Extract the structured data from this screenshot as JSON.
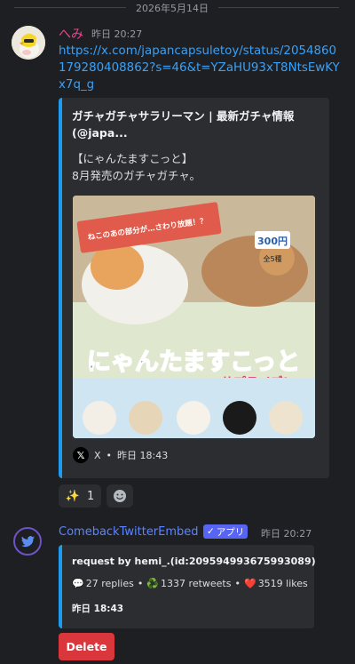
{
  "date_divider": "2026年5月14日",
  "message1": {
    "author": "へみ",
    "timestamp": "昨日 20:27",
    "link": "https://x.com/japancapsuletoy/status/2054860179280408862?s=46&t=YZaHU93xT8NtsEwKYx7q_g",
    "embed": {
      "title": "ガチャガチャサラリーマン | 最新ガチャ情報 (@japa...",
      "description_lines": [
        "【にゃんたますこっと】",
        "8月発売のガチャガチャ。"
      ],
      "image": {
        "banner_text": "ねこのあの部分が…さわり放題！？",
        "price": "300円",
        "count": "全5種",
        "product_title": "にゃんたますこっと",
        "subtitle": "サプライズ!"
      },
      "footer_source": "X",
      "footer_time": "昨日 18:43"
    },
    "reactions": [
      {
        "emoji": "✨",
        "count": "1"
      }
    ],
    "add_reaction_icon": "smiley-icon"
  },
  "message2": {
    "author": "ComebackTwitterEmbed",
    "app_badge": "アプリ",
    "timestamp": "昨日 20:27",
    "embed": {
      "request": "request by hemi_.(id:209594993675993089)",
      "replies": "27 replies",
      "retweets": "1337 retweets",
      "likes": "3519 likes",
      "time": "昨日 18:43"
    },
    "delete_label": "Delete"
  },
  "colors": {
    "background": "#1e1f22",
    "embed_bg": "#2b2d31",
    "embed_accent": "#1d9bf0",
    "link": "#3aa1f7",
    "author1": "#f0428f",
    "author2": "#5b84ff",
    "app_badge": "#5865f2",
    "delete": "#da373c"
  }
}
